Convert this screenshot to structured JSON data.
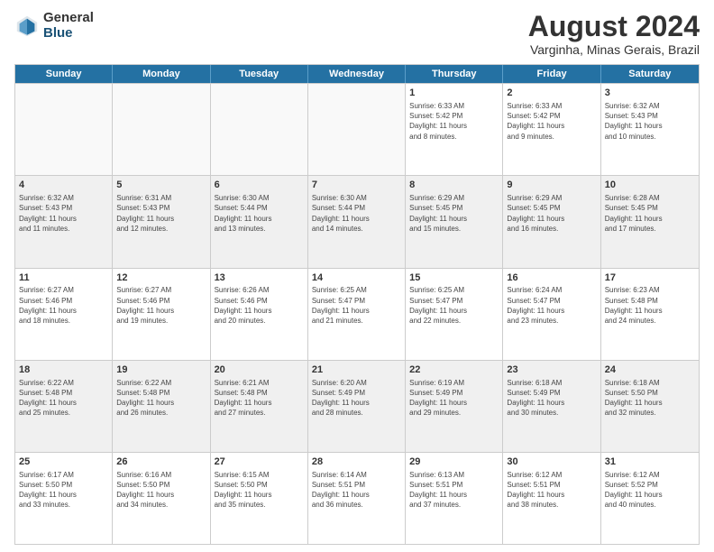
{
  "logo": {
    "general": "General",
    "blue": "Blue"
  },
  "title": "August 2024",
  "subtitle": "Varginha, Minas Gerais, Brazil",
  "header_days": [
    "Sunday",
    "Monday",
    "Tuesday",
    "Wednesday",
    "Thursday",
    "Friday",
    "Saturday"
  ],
  "weeks": [
    [
      {
        "day": "",
        "info": ""
      },
      {
        "day": "",
        "info": ""
      },
      {
        "day": "",
        "info": ""
      },
      {
        "day": "",
        "info": ""
      },
      {
        "day": "1",
        "info": "Sunrise: 6:33 AM\nSunset: 5:42 PM\nDaylight: 11 hours\nand 8 minutes."
      },
      {
        "day": "2",
        "info": "Sunrise: 6:33 AM\nSunset: 5:42 PM\nDaylight: 11 hours\nand 9 minutes."
      },
      {
        "day": "3",
        "info": "Sunrise: 6:32 AM\nSunset: 5:43 PM\nDaylight: 11 hours\nand 10 minutes."
      }
    ],
    [
      {
        "day": "4",
        "info": "Sunrise: 6:32 AM\nSunset: 5:43 PM\nDaylight: 11 hours\nand 11 minutes."
      },
      {
        "day": "5",
        "info": "Sunrise: 6:31 AM\nSunset: 5:43 PM\nDaylight: 11 hours\nand 12 minutes."
      },
      {
        "day": "6",
        "info": "Sunrise: 6:30 AM\nSunset: 5:44 PM\nDaylight: 11 hours\nand 13 minutes."
      },
      {
        "day": "7",
        "info": "Sunrise: 6:30 AM\nSunset: 5:44 PM\nDaylight: 11 hours\nand 14 minutes."
      },
      {
        "day": "8",
        "info": "Sunrise: 6:29 AM\nSunset: 5:45 PM\nDaylight: 11 hours\nand 15 minutes."
      },
      {
        "day": "9",
        "info": "Sunrise: 6:29 AM\nSunset: 5:45 PM\nDaylight: 11 hours\nand 16 minutes."
      },
      {
        "day": "10",
        "info": "Sunrise: 6:28 AM\nSunset: 5:45 PM\nDaylight: 11 hours\nand 17 minutes."
      }
    ],
    [
      {
        "day": "11",
        "info": "Sunrise: 6:27 AM\nSunset: 5:46 PM\nDaylight: 11 hours\nand 18 minutes."
      },
      {
        "day": "12",
        "info": "Sunrise: 6:27 AM\nSunset: 5:46 PM\nDaylight: 11 hours\nand 19 minutes."
      },
      {
        "day": "13",
        "info": "Sunrise: 6:26 AM\nSunset: 5:46 PM\nDaylight: 11 hours\nand 20 minutes."
      },
      {
        "day": "14",
        "info": "Sunrise: 6:25 AM\nSunset: 5:47 PM\nDaylight: 11 hours\nand 21 minutes."
      },
      {
        "day": "15",
        "info": "Sunrise: 6:25 AM\nSunset: 5:47 PM\nDaylight: 11 hours\nand 22 minutes."
      },
      {
        "day": "16",
        "info": "Sunrise: 6:24 AM\nSunset: 5:47 PM\nDaylight: 11 hours\nand 23 minutes."
      },
      {
        "day": "17",
        "info": "Sunrise: 6:23 AM\nSunset: 5:48 PM\nDaylight: 11 hours\nand 24 minutes."
      }
    ],
    [
      {
        "day": "18",
        "info": "Sunrise: 6:22 AM\nSunset: 5:48 PM\nDaylight: 11 hours\nand 25 minutes."
      },
      {
        "day": "19",
        "info": "Sunrise: 6:22 AM\nSunset: 5:48 PM\nDaylight: 11 hours\nand 26 minutes."
      },
      {
        "day": "20",
        "info": "Sunrise: 6:21 AM\nSunset: 5:48 PM\nDaylight: 11 hours\nand 27 minutes."
      },
      {
        "day": "21",
        "info": "Sunrise: 6:20 AM\nSunset: 5:49 PM\nDaylight: 11 hours\nand 28 minutes."
      },
      {
        "day": "22",
        "info": "Sunrise: 6:19 AM\nSunset: 5:49 PM\nDaylight: 11 hours\nand 29 minutes."
      },
      {
        "day": "23",
        "info": "Sunrise: 6:18 AM\nSunset: 5:49 PM\nDaylight: 11 hours\nand 30 minutes."
      },
      {
        "day": "24",
        "info": "Sunrise: 6:18 AM\nSunset: 5:50 PM\nDaylight: 11 hours\nand 32 minutes."
      }
    ],
    [
      {
        "day": "25",
        "info": "Sunrise: 6:17 AM\nSunset: 5:50 PM\nDaylight: 11 hours\nand 33 minutes."
      },
      {
        "day": "26",
        "info": "Sunrise: 6:16 AM\nSunset: 5:50 PM\nDaylight: 11 hours\nand 34 minutes."
      },
      {
        "day": "27",
        "info": "Sunrise: 6:15 AM\nSunset: 5:50 PM\nDaylight: 11 hours\nand 35 minutes."
      },
      {
        "day": "28",
        "info": "Sunrise: 6:14 AM\nSunset: 5:51 PM\nDaylight: 11 hours\nand 36 minutes."
      },
      {
        "day": "29",
        "info": "Sunrise: 6:13 AM\nSunset: 5:51 PM\nDaylight: 11 hours\nand 37 minutes."
      },
      {
        "day": "30",
        "info": "Sunrise: 6:12 AM\nSunset: 5:51 PM\nDaylight: 11 hours\nand 38 minutes."
      },
      {
        "day": "31",
        "info": "Sunrise: 6:12 AM\nSunset: 5:52 PM\nDaylight: 11 hours\nand 40 minutes."
      }
    ]
  ]
}
